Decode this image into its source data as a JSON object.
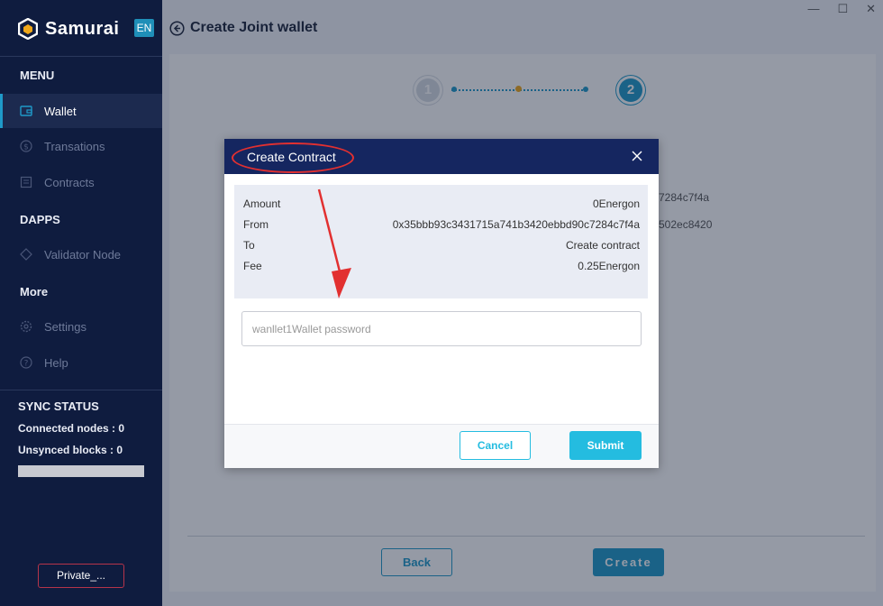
{
  "brand": {
    "name": "Samurai",
    "lang": "EN"
  },
  "sidebar": {
    "menu_title": "MENU",
    "items": [
      {
        "label": "Wallet",
        "icon": "wallet-icon"
      },
      {
        "label": "Transations",
        "icon": "dollar-icon"
      },
      {
        "label": "Contracts",
        "icon": "contract-icon"
      }
    ],
    "dapps_title": "DAPPS",
    "dapps_items": [
      {
        "label": "Validator Node",
        "icon": "node-icon"
      }
    ],
    "more_title": "More",
    "more_items": [
      {
        "label": "Settings",
        "icon": "gear-icon"
      },
      {
        "label": "Help",
        "icon": "help-icon"
      }
    ],
    "sync": {
      "title": "SYNC STATUS",
      "connected_nodes": "Connected nodes : 0",
      "unsynced_blocks": "Unsynced blocks : 0"
    },
    "private_button": "Private_..."
  },
  "header": {
    "title": "Create Joint wallet"
  },
  "stepper": {
    "step1": "1",
    "step2": "2"
  },
  "background": {
    "partial_line_1": "7284c7f4a",
    "partial_line_2": "502ec8420",
    "back_button": "Back",
    "create_button": "Create"
  },
  "modal": {
    "title": "Create Contract",
    "rows": [
      {
        "label": "Amount",
        "value": "0Energon"
      },
      {
        "label": "From",
        "value": "0x35bbb93c3431715a741b3420ebbd90c7284c7f4a"
      },
      {
        "label": "To",
        "value": "Create contract"
      },
      {
        "label": "Fee",
        "value": "0.25Energon"
      }
    ],
    "password_placeholder": "wanllet1Wallet password",
    "cancel_button": "Cancel",
    "submit_button": "Submit"
  },
  "colors": {
    "sidebar_bg": "#0f1c3f",
    "accent": "#1f9ac9",
    "modal_header": "#152660",
    "submit": "#24bce0",
    "annotation": "#e23030"
  }
}
